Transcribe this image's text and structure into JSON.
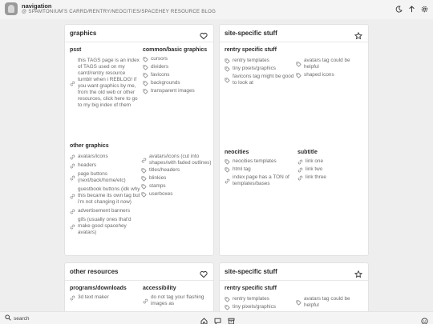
{
  "nav": {
    "title": "navigation",
    "subtitle": "SPAMTONIUM'S CARRD/RENTRY/NEOCITIES/SPACEHEY RESOURCE BLOG",
    "at": "@"
  },
  "search": {
    "placeholder": "search"
  },
  "cards": {
    "graphics": {
      "title": "graphics",
      "psst": {
        "heading": "psst",
        "items": [
          "this TAGS page is an index of TAGS used on my carrd/rentry resource tumblr when i REBLOG! if you want graphics by me, from the old web or other resources, click here to go to my big index of them"
        ]
      },
      "common": {
        "heading": "common/basic graphics",
        "items": [
          "cursors",
          "dividers",
          "favicons",
          "backgrounds",
          "transparent images"
        ]
      },
      "other": {
        "heading": "other graphics",
        "left": [
          "avatars/icons",
          "headers",
          "page buttons (next/back/home/etc)",
          "guestbook buttons (idk why this became its own tag but i'm not changing it now)",
          "advertisement banners",
          "gifs (usually ones that'd make good spacehey avatars)"
        ],
        "right": [
          "avatars/icons (cut into shapes/with faded outlines)",
          "titles/headers",
          "blinkies",
          "stamps",
          "userboxes"
        ]
      }
    },
    "site_specific": {
      "title": "site-specific stuff",
      "rentry": {
        "heading": "rentry specific stuff",
        "left": [
          "rentry templates",
          "tiny pixels/graphics",
          "favicons tag might be good to look at"
        ],
        "right": [
          "avatars tag could be helpful",
          "shaped icons"
        ]
      },
      "neocities": {
        "heading": "neocities",
        "items": [
          "neocities templates",
          "html tag",
          "index page has a TON of templates/bases"
        ]
      },
      "subtitle": {
        "heading": "subtitle",
        "items": [
          "link one",
          "link two",
          "link three"
        ]
      }
    },
    "other_resources": {
      "title": "other resources",
      "programs": {
        "heading": "programs/downloads",
        "items": [
          "3d text maker"
        ]
      },
      "accessibility": {
        "heading": "accessibility",
        "items": [
          "do not tag your flashing images as"
        ]
      }
    },
    "site_specific_2": {
      "title": "site-specific stuff",
      "rentry": {
        "heading": "rentry specific stuff",
        "left": [
          "rentry templates",
          "tiny pixels/graphics"
        ],
        "right": [
          "avatars tag could be helpful"
        ]
      }
    }
  },
  "colors": {
    "background": "#eeeeee",
    "card": "#ffffff",
    "text": "#2b2b2b",
    "muted": "#6a6a6a"
  },
  "icons": {
    "top": [
      "moon-icon",
      "arrow-up-icon",
      "gear-icon"
    ],
    "bottom": [
      "search-icon",
      "home-icon",
      "chat-icon",
      "archive-icon",
      "face-icon"
    ],
    "card": [
      "heart-icon",
      "star-icon"
    ],
    "items": [
      "link-icon",
      "tag-icon"
    ]
  }
}
